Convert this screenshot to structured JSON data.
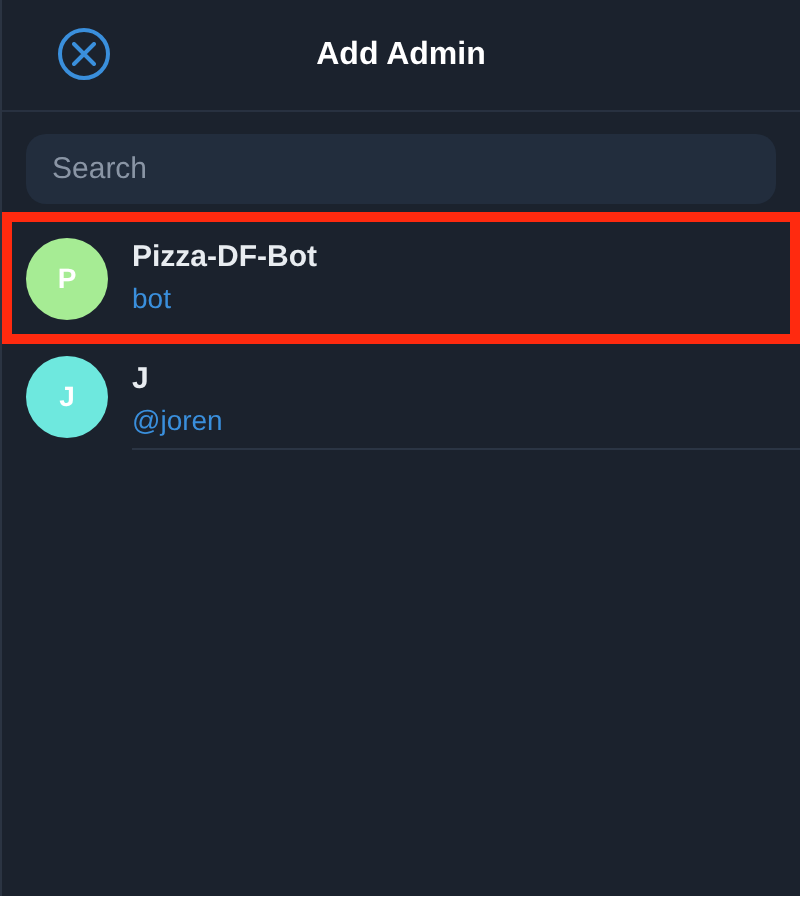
{
  "header": {
    "title": "Add Admin"
  },
  "search": {
    "placeholder": "Search"
  },
  "contacts": [
    {
      "initial": "P",
      "name": "Pizza-DF-Bot",
      "subtitle": "bot",
      "color": "#a6ec94",
      "highlighted": true
    },
    {
      "initial": "J",
      "name": "J",
      "subtitle": "@joren",
      "color": "#6ee8de",
      "highlighted": false
    }
  ]
}
